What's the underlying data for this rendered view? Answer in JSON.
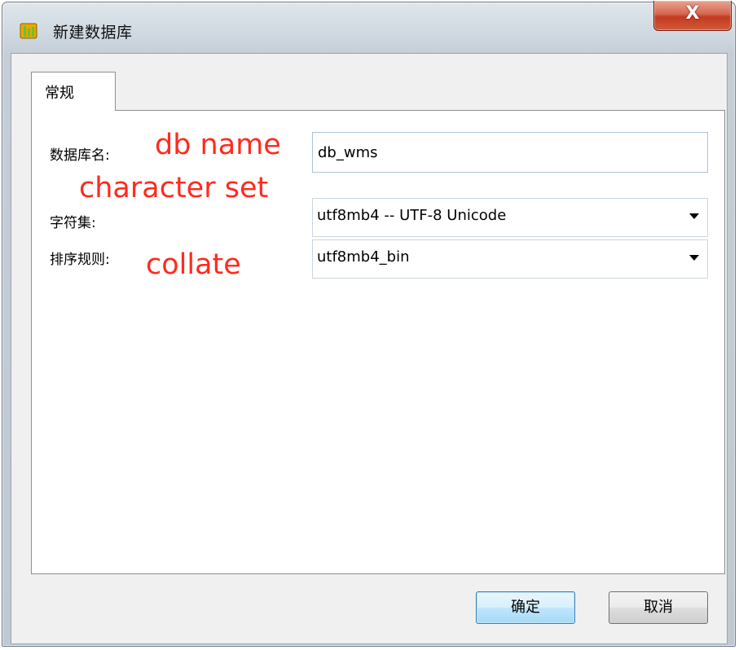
{
  "window": {
    "title": "新建数据库",
    "close_symbol": "X"
  },
  "tabs": [
    {
      "label": "常规",
      "active": true
    }
  ],
  "form": {
    "db_name": {
      "label": "数据库名:",
      "value": "db_wms"
    },
    "charset": {
      "label": "字符集:",
      "value": "utf8mb4 -- UTF-8 Unicode"
    },
    "collation": {
      "label": "排序规则:",
      "value": "utf8mb4_bin"
    }
  },
  "annotations": {
    "db_name": "db name",
    "charset": "character set",
    "collation": "collate"
  },
  "buttons": {
    "ok": "确定",
    "cancel": "取消"
  },
  "colors": {
    "annotation": "#ff2a1e",
    "close_button": "#c43a1f",
    "default_button_border": "#3c7fb1"
  },
  "icons": {
    "app": "database-icon",
    "close": "close-icon",
    "dropdown": "chevron-down-icon"
  }
}
